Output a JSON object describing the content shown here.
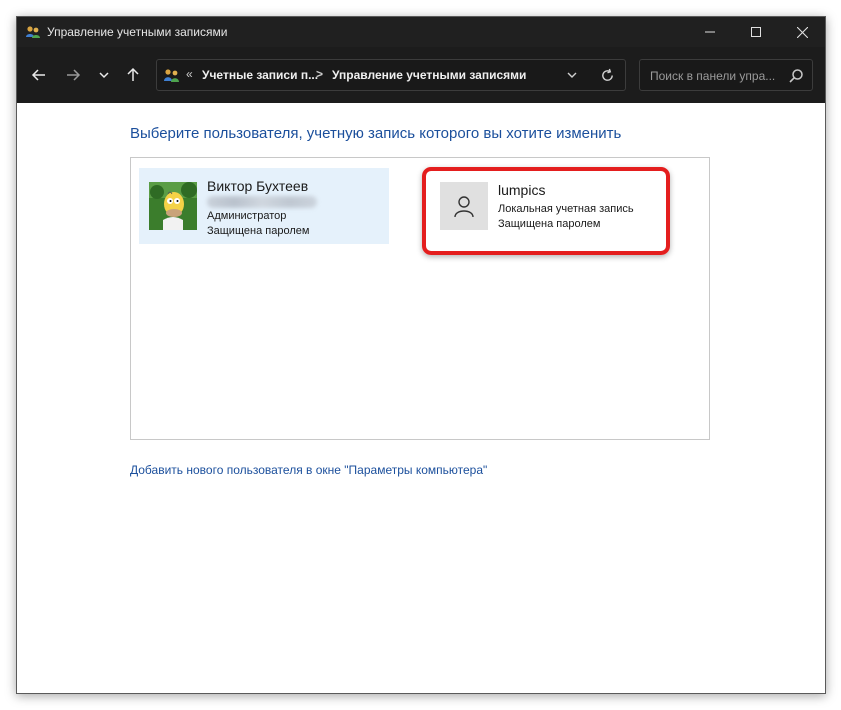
{
  "window": {
    "title": "Управление учетными записями",
    "icon": "users-icon"
  },
  "navigation": {
    "back": "arrow-left-icon",
    "forward": "arrow-right-icon",
    "recent": "chevron-down-icon",
    "up": "arrow-up-icon"
  },
  "address_bar": {
    "overflow": "«",
    "crumbs": [
      "Учетные записи п...",
      "Управление учетными записями"
    ],
    "separator": ">"
  },
  "search": {
    "placeholder": "Поиск в панели упра..."
  },
  "main": {
    "heading": "Выберите пользователя, учетную запись которого вы хотите изменить",
    "accounts": [
      {
        "name": "Виктор Бухтеев",
        "role": "Администратор",
        "status": "Защищена паролем",
        "avatar": "cartoon-avatar",
        "selected": true,
        "highlight_color": "#e5f1fb"
      },
      {
        "name": "lumpics",
        "role": "Локальная учетная запись",
        "status": "Защищена паролем",
        "avatar": "generic-user-icon",
        "annotated": true
      }
    ],
    "add_user_link": "Добавить нового пользователя в окне \"Параметры компьютера\""
  },
  "colors": {
    "titlebar": "#202020",
    "navbar": "#1c1c1c",
    "link": "#1b4f9c",
    "annotation": "#e41e1e",
    "selection": "#e5f1fb"
  }
}
